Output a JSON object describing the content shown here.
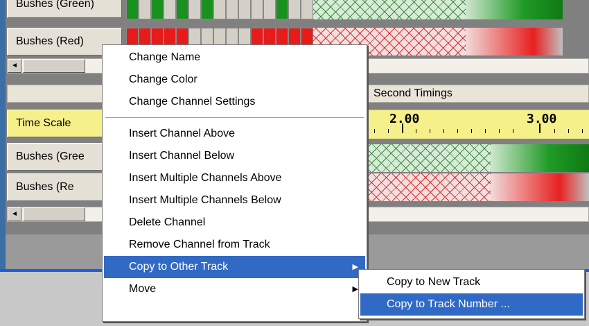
{
  "channels": {
    "top_green": "Bushes (Green)",
    "top_red": "Bushes (Red)",
    "time_scale": "Time Scale",
    "bottom_green": "Bushes (Gree",
    "bottom_red": "Bushes (Re"
  },
  "timing_header": {
    "label": "Second Timings"
  },
  "ruler": {
    "marks": [
      "2.00",
      "3.00"
    ]
  },
  "scrollbar": {
    "left_arrow": "◄"
  },
  "colors": {
    "on_green": "#19911f",
    "on_red": "#e81a1a",
    "time_scale_bg": "#f5f08a",
    "menu_highlight": "#316ac5"
  },
  "context_menu": {
    "group1": [
      "Change Name",
      "Change Color",
      "Change Channel Settings"
    ],
    "group2": [
      "Insert Channel Above",
      "Insert Channel Below",
      "Insert Multiple Channels Above",
      "Insert Multiple Channels Below",
      "Delete Channel",
      "Remove Channel from Track",
      "Copy to Other Track",
      "Move"
    ],
    "submenu_arrow": "▶"
  },
  "submenu": [
    "Copy to New Track",
    "Copy to Track Number ..."
  ]
}
